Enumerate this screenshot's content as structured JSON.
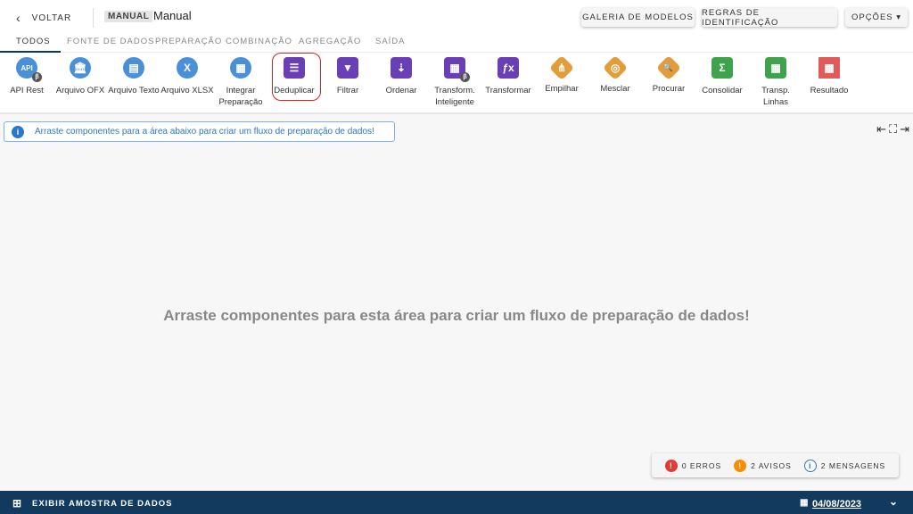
{
  "header": {
    "back_label": "VOLTAR",
    "badge": "MANUAL",
    "title": "Manual",
    "buttons": {
      "gallery": "GALERIA DE MODELOS",
      "rules": "REGRAS DE IDENTIFICAÇÃO",
      "options": "OPÇÕES ▾"
    }
  },
  "tabs": [
    "TODOS",
    "FONTE DE DADOS",
    "PREPARAÇÃO",
    "COMBINAÇÃO",
    "AGREGAÇÃO",
    "SAÍDA"
  ],
  "components": [
    {
      "label": "API Rest",
      "glyph": "API"
    },
    {
      "label": "Arquivo OFX",
      "glyph": "🏛"
    },
    {
      "label": "Arquivo Texto",
      "glyph": "▤"
    },
    {
      "label": "Arquivo XLSX",
      "glyph": "X"
    },
    {
      "label": "Integrar Preparação",
      "glyph": "▦"
    },
    {
      "label": "Deduplicar",
      "glyph": "☰"
    },
    {
      "label": "Filtrar",
      "glyph": "▼"
    },
    {
      "label": "Ordenar",
      "glyph": "⇣"
    },
    {
      "label": "Transform. Inteligente",
      "glyph": "▦"
    },
    {
      "label": "Transformar",
      "glyph": "ƒx"
    },
    {
      "label": "Empilhar",
      "glyph": "⋔"
    },
    {
      "label": "Mesclar",
      "glyph": "◎"
    },
    {
      "label": "Procurar",
      "glyph": "🔍"
    },
    {
      "label": "Consolidar",
      "glyph": "Σ"
    },
    {
      "label": "Transp. Linhas",
      "glyph": "▦"
    },
    {
      "label": "Resultado",
      "glyph": "▦"
    }
  ],
  "beta": "β",
  "info_text": "Arraste componentes para a área abaixo para criar um fluxo de preparação de dados!",
  "canvas_empty": "Arraste componentes para esta área para criar um fluxo de preparação de dados!",
  "status": {
    "errors": "0 ERROS",
    "warnings": "2 AVISOS",
    "messages": "2 MENSAGENS"
  },
  "bottom": {
    "label": "EXIBIR AMOSTRA DE DADOS",
    "date": "04/08/2023"
  }
}
